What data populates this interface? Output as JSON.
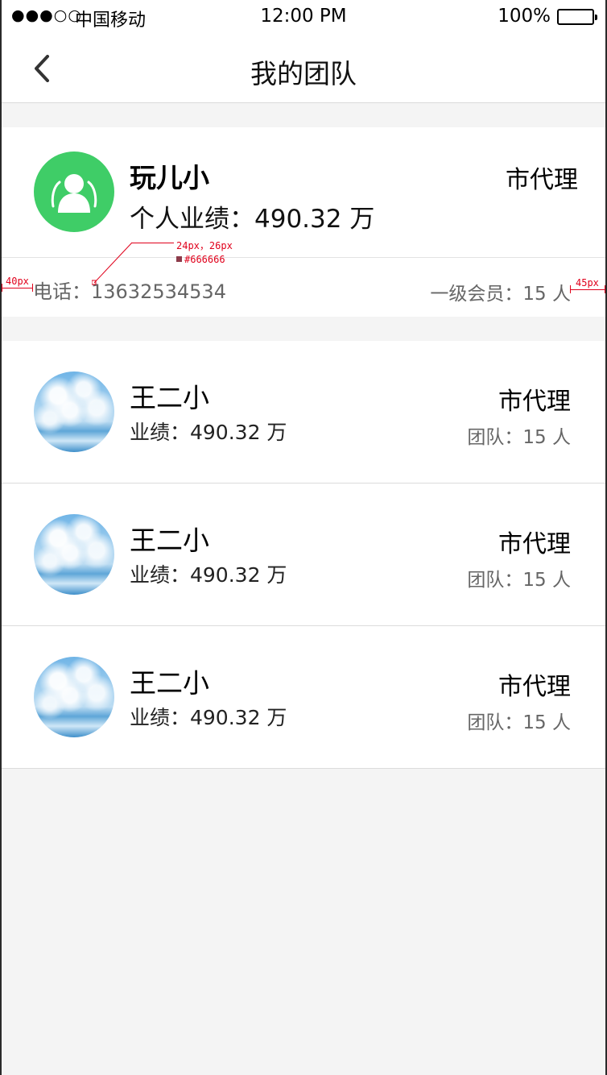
{
  "status_bar": {
    "signal": "●●●○○",
    "carrier": "中国移动",
    "time": "12:00 PM",
    "battery": "100%"
  },
  "nav": {
    "title": "我的团队"
  },
  "me": {
    "name": "玩儿小",
    "performance": "个人业绩：490.32 万",
    "level": "市代理",
    "phone": "电话：13632534534",
    "members": "一级会员：15 人"
  },
  "annotations": {
    "font_spec": "24px，26px",
    "color_spec": "#666666",
    "left_spacing": "40px",
    "right_spacing": "45px"
  },
  "team": [
    {
      "name": "王二小",
      "performance": "业绩：490.32 万",
      "level": "市代理",
      "team": "团队：15 人"
    },
    {
      "name": "王二小",
      "performance": "业绩：490.32 万",
      "level": "市代理",
      "team": "团队：15 人"
    },
    {
      "name": "王二小",
      "performance": "业绩：490.32 万",
      "level": "市代理",
      "team": "团队：15 人"
    }
  ],
  "colors": {
    "accent_green": "#3fcd67",
    "secondary_text": "#666666",
    "background": "#f4f4f4"
  }
}
